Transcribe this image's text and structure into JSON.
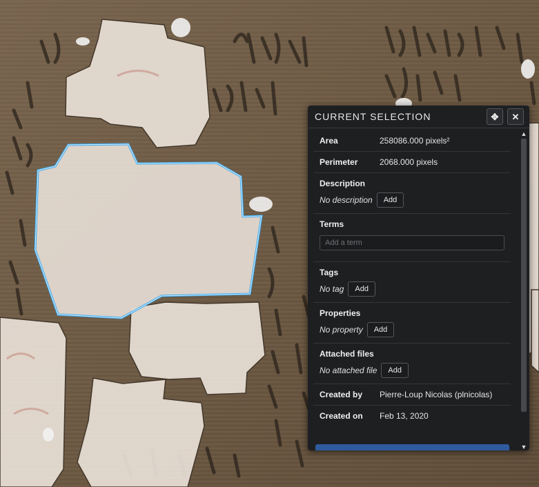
{
  "panel": {
    "title": "CURRENT SELECTION",
    "move_icon": "✥",
    "close_icon": "✕",
    "area": {
      "label": "Area",
      "value": "258086.000 pixels²"
    },
    "perimeter": {
      "label": "Perimeter",
      "value": "2068.000 pixels"
    },
    "description": {
      "label": "Description",
      "empty": "No description",
      "add": "Add"
    },
    "terms": {
      "label": "Terms",
      "placeholder": "Add a term"
    },
    "tags": {
      "label": "Tags",
      "empty": "No tag",
      "add": "Add"
    },
    "properties": {
      "label": "Properties",
      "empty": "No property",
      "add": "Add"
    },
    "attached_files": {
      "label": "Attached files",
      "empty": "No attached file",
      "add": "Add"
    },
    "created_by": {
      "label": "Created by",
      "value": "Pierre-Loup Nicolas (plnicolas)"
    },
    "created_on": {
      "label": "Created on",
      "value": "Feb 13, 2020"
    }
  },
  "scroll": {
    "up": "▲",
    "down": "▼"
  },
  "colors": {
    "selection_outline": "#3aa8f0",
    "panel_bg": "#1e1f21",
    "primary_button": "#2f5a9e"
  }
}
